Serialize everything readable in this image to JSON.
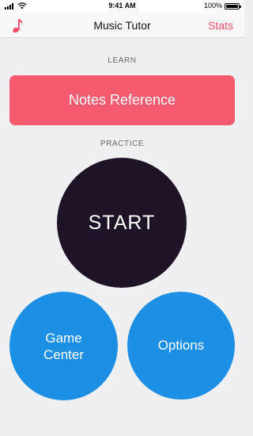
{
  "status_bar": {
    "time": "9:41 AM",
    "battery": "100%"
  },
  "nav": {
    "title": "Music Tutor",
    "stats_label": "Stats",
    "left_icon": "music-note-icon"
  },
  "sections": {
    "learn_label": "LEARN",
    "practice_label": "PRACTICE"
  },
  "buttons": {
    "notes_reference": "Notes Reference",
    "start": "START",
    "game_center": "Game\nCenter",
    "options": "Options"
  },
  "colors": {
    "accent_pink": "#f45b6e",
    "stats_pink": "#f0506a",
    "start_dark": "#1f1328",
    "action_blue": "#1d90e6"
  }
}
